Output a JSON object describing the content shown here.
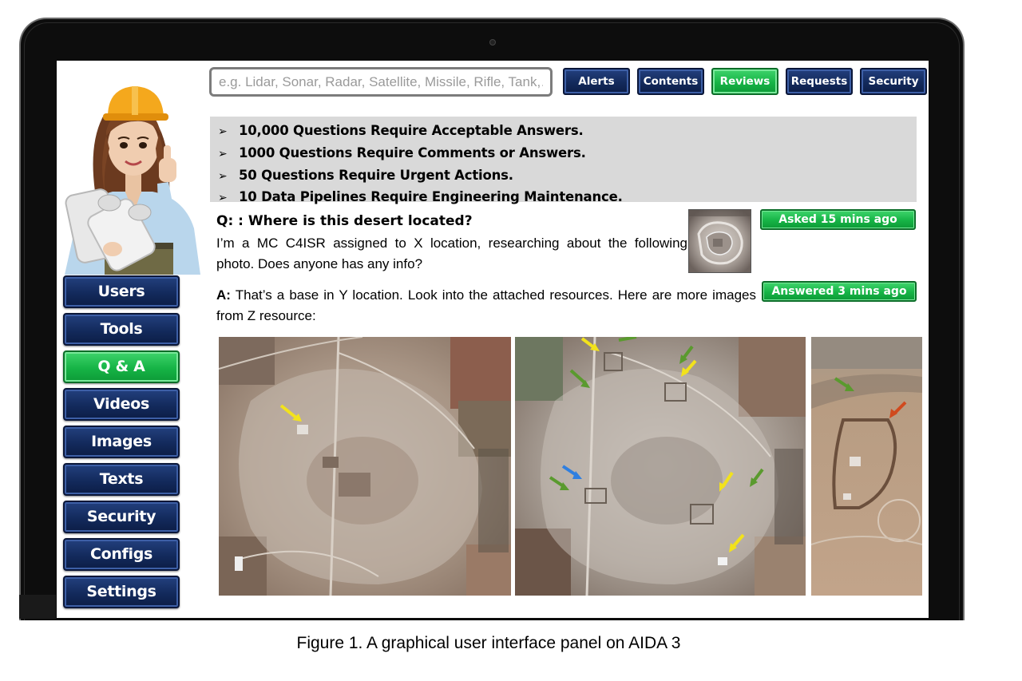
{
  "search": {
    "placeholder": "e.g. Lidar, Sonar, Radar, Satellite, Missile, Rifle, Tank,…"
  },
  "topnav": [
    {
      "label": "Alerts",
      "active": false
    },
    {
      "label": "Contents",
      "active": false
    },
    {
      "label": "Reviews",
      "active": true
    },
    {
      "label": "Requests",
      "active": false
    },
    {
      "label": "Security",
      "active": false
    }
  ],
  "sidebar": [
    {
      "label": "Users",
      "active": false
    },
    {
      "label": "Tools",
      "active": false
    },
    {
      "label": "Q & A",
      "active": true
    },
    {
      "label": "Videos",
      "active": false
    },
    {
      "label": "Images",
      "active": false
    },
    {
      "label": "Texts",
      "active": false
    },
    {
      "label": "Security",
      "active": false
    },
    {
      "label": "Configs",
      "active": false
    },
    {
      "label": "Settings",
      "active": false
    }
  ],
  "notices": [
    "10,000 Questions Require Acceptable Answers.",
    "1000 Questions Require Comments or Answers.",
    "50 Questions Require Urgent Actions.",
    "10 Data Pipelines Require Engineering Maintenance."
  ],
  "question": {
    "title": "Q: : Where is this desert located?",
    "body": "I’m a MC C4ISR assigned to X location, researching about the following photo. Does anyone has any info?",
    "status": "Asked 15 mins ago"
  },
  "answer": {
    "label": "A:",
    "body": "That’s a base in Y location. Look into the attached resources. Here are more images from Z resource:",
    "status": "Answered 3 mins ago"
  },
  "caption": "Figure 1. A graphical user interface panel on AIDA 3",
  "colors": {
    "nav_blue": "#132a5c",
    "active_green": "#16b446",
    "notice_bg": "#d9d9d9",
    "arrow_yellow": "#f2e21c",
    "arrow_green": "#5a9a2e",
    "arrow_blue": "#2f7fe0",
    "arrow_red": "#d04a1e"
  }
}
